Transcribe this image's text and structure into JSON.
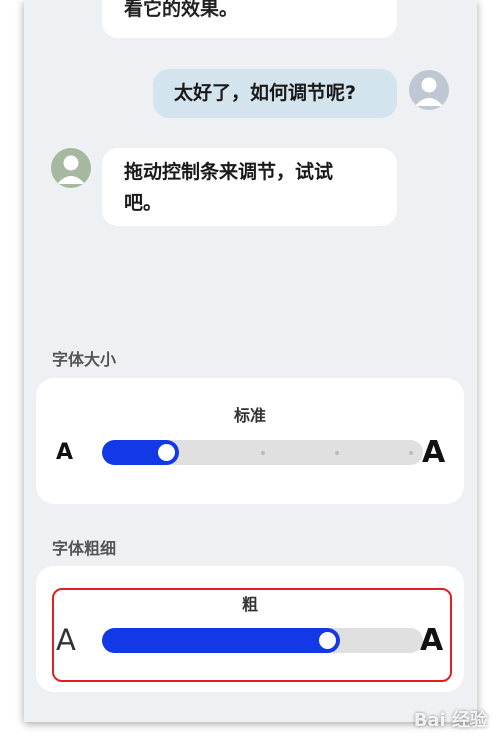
{
  "chat": {
    "top_bubble_text": "看它的效果。",
    "user_message": "太好了，如何调节呢?",
    "bot_message_line1": "拖动控制条来调节，试试",
    "bot_message_line2": "吧。"
  },
  "font_size": {
    "section_label": "字体大小",
    "value_label": "标准",
    "small_letter": "A",
    "large_letter": "A",
    "level_fraction": 0.24,
    "steps": 5,
    "selected_step": 2
  },
  "font_weight": {
    "section_label": "字体粗细",
    "value_label": "粗",
    "light_letter": "A",
    "bold_letter": "A",
    "level_fraction": 0.74
  },
  "colors": {
    "accent": "#1339e6",
    "highlight_border": "#e02020",
    "user_bubble": "#d3e4ee"
  },
  "watermark": "Bai 经验"
}
